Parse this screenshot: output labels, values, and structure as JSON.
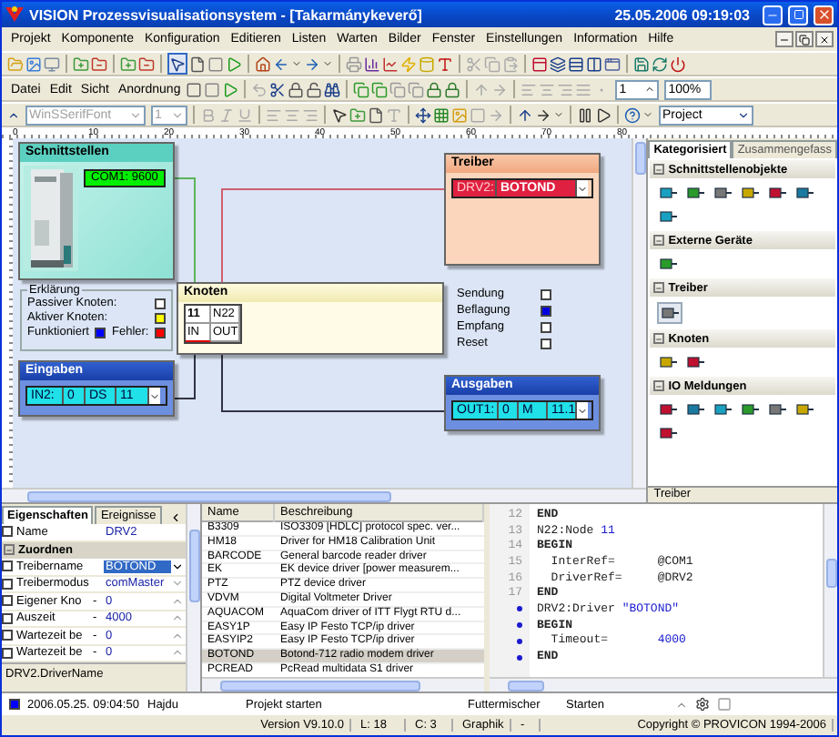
{
  "window": {
    "title": "VISION Prozessvisualisationsystem - [Takarmánykeverő]",
    "clock": "25.05.2006 09:19:03"
  },
  "menu": [
    "Projekt",
    "Komponente",
    "Konfiguration",
    "Editieren",
    "Listen",
    "Warten",
    "Bilder",
    "Fenster",
    "Einstellungen",
    "Information",
    "Hilfe"
  ],
  "toolbar2": {
    "menus": [
      "Datei",
      "Edit",
      "Sicht",
      "Anordnung"
    ],
    "step_field": "1",
    "zoom_field": "100%"
  },
  "toolbar3": {
    "font": {
      "value": "WinSSerifFont",
      "disabled": true
    },
    "size": {
      "value": "1",
      "disabled": true
    },
    "scope": {
      "value": "Project",
      "disabled": false
    }
  },
  "ruler": {
    "labels": [
      "0",
      "10",
      "20",
      "30",
      "40",
      "50",
      "60",
      "70",
      "80"
    ]
  },
  "canvas": {
    "interfaces": {
      "title": "Schnittstellen",
      "port": "COM1: 9600"
    },
    "legend": {
      "title": "Erklärung",
      "items": [
        {
          "label": "Passiver Knoten:",
          "color": "#ffffff"
        },
        {
          "label": "Aktiver Knoten:",
          "color": "#ffff00"
        },
        {
          "label": "Funktioniert",
          "color": "#0000ff"
        },
        {
          "label": "Fehler:",
          "color": "#ff0000"
        }
      ]
    },
    "inputs": {
      "title": "Eingaben",
      "cells": [
        "IN2:",
        "0",
        "DS",
        "11"
      ]
    },
    "node": {
      "title": "Knoten",
      "cells": [
        "11",
        "N22",
        "IN",
        "OUT"
      ]
    },
    "signals": [
      {
        "label": "Sendung",
        "on": false
      },
      {
        "label": "Beflagung",
        "on": true
      },
      {
        "label": "Empfang",
        "on": false
      },
      {
        "label": "Reset",
        "on": false
      }
    ],
    "driver": {
      "title": "Treiber",
      "cells": [
        "DRV2:",
        "BOTOND"
      ]
    },
    "outputs": {
      "title": "Ausgaben",
      "cells": [
        "OUT1:",
        "0",
        "M",
        "11.1"
      ]
    }
  },
  "palette": {
    "tabs": [
      {
        "label": "Kategorisiert",
        "selected": true
      },
      {
        "label": "Zusammengefass",
        "selected": false
      }
    ],
    "sections": [
      {
        "title": "Schnittstellenobjekte",
        "expanded": true,
        "tools": [
          {
            "selected": false
          },
          {
            "selected": false
          },
          {
            "selected": false
          },
          {
            "selected": false
          },
          {
            "selected": false
          },
          {
            "selected": false
          },
          {
            "selected": false
          }
        ]
      },
      {
        "title": "Externe Geräte",
        "expanded": true,
        "tools": [
          {
            "selected": false
          }
        ]
      },
      {
        "title": "Treiber",
        "expanded": true,
        "tools": [
          {
            "selected": true
          }
        ]
      },
      {
        "title": "Knoten",
        "expanded": true,
        "tools": [
          {
            "selected": false
          },
          {
            "selected": false
          }
        ]
      },
      {
        "title": "IO Meldungen",
        "expanded": true,
        "tools": [
          {
            "selected": false
          },
          {
            "selected": false
          },
          {
            "selected": false
          },
          {
            "selected": false
          },
          {
            "selected": false
          },
          {
            "selected": false
          },
          {
            "selected": false
          }
        ]
      }
    ],
    "footer": "Treiber"
  },
  "properties": {
    "tabs": [
      {
        "label": "Eigenschaften",
        "selected": true
      },
      {
        "label": "Ereignisse",
        "selected": false
      }
    ],
    "rows": [
      {
        "kind": "property",
        "label": "Name",
        "value": "DRV2",
        "selected": false
      },
      {
        "kind": "group",
        "label": "Zuordnen",
        "expanded": true
      },
      {
        "kind": "dropdown",
        "label": "Treibername",
        "value": "BOTOND",
        "selected": true
      },
      {
        "kind": "dropdown",
        "label": "Treibermodus",
        "value": "comMaster",
        "selected": false
      },
      {
        "kind": "spin",
        "label": "Eigener Kno",
        "marker": "-",
        "value": "0",
        "selected": false
      },
      {
        "kind": "spin",
        "label": "Auszeit",
        "marker": "-",
        "value": "4000",
        "selected": false
      },
      {
        "kind": "spin",
        "label": "Wartezeit be",
        "marker": "-",
        "value": "0",
        "selected": false
      },
      {
        "kind": "spin",
        "label": "Wartezeit be",
        "marker": "-",
        "value": "0",
        "selected": false
      }
    ],
    "footer": "DRV2.DriverName"
  },
  "drivers": {
    "columns": [
      "Name",
      "Beschreibung"
    ],
    "rows": [
      {
        "name": "B3309",
        "description": "ISO3309 [HDLC] protocol spec. ver...",
        "selected": false
      },
      {
        "name": "HM18",
        "description": "Driver for HM18 Calibration Unit",
        "selected": false
      },
      {
        "name": "BARCODE",
        "description": "General barcode reader driver",
        "selected": false
      },
      {
        "name": "EK",
        "description": "EK device driver [power measurem...",
        "selected": false
      },
      {
        "name": "PTZ",
        "description": "PTZ device driver",
        "selected": false
      },
      {
        "name": "VDVM",
        "description": "Digital Voltmeter Driver",
        "selected": false
      },
      {
        "name": "AQUACOM",
        "description": "AquaCom driver of ITT Flygt RTU d...",
        "selected": false
      },
      {
        "name": "EASY1P",
        "description": "Easy IP Festo TCP/ip driver",
        "selected": false
      },
      {
        "name": "EASYIP2",
        "description": "Easy IP Festo TCP/ip driver",
        "selected": false
      },
      {
        "name": "BOTOND",
        "description": "Botond-712 radio modem driver",
        "selected": true
      },
      {
        "name": "PCREAD",
        "description": "PcRead multidata S1 driver",
        "selected": false
      }
    ]
  },
  "code": {
    "lines": [
      {
        "gutter": "12",
        "marker": false,
        "tokens": [
          {
            "text": "END",
            "kind": "keyword"
          }
        ]
      },
      {
        "gutter": "13",
        "marker": false,
        "tokens": [
          {
            "text": "N22:Node ",
            "kind": "plain"
          },
          {
            "text": "11",
            "kind": "number"
          }
        ]
      },
      {
        "gutter": "14",
        "marker": false,
        "tokens": [
          {
            "text": "BEGIN",
            "kind": "keyword"
          }
        ]
      },
      {
        "gutter": "15",
        "marker": false,
        "tokens": [
          {
            "text": "  InterRef=      ",
            "kind": "plain"
          },
          {
            "text": "@COM1",
            "kind": "plain"
          }
        ]
      },
      {
        "gutter": "16",
        "marker": false,
        "tokens": [
          {
            "text": "  DriverRef=     ",
            "kind": "plain"
          },
          {
            "text": "@DRV2",
            "kind": "plain"
          }
        ]
      },
      {
        "gutter": "17",
        "marker": false,
        "tokens": [
          {
            "text": "END",
            "kind": "keyword"
          }
        ]
      },
      {
        "marker": true,
        "tokens": [
          {
            "text": "DRV2:Driver ",
            "kind": "plain"
          },
          {
            "text": "\"BOTOND\"",
            "kind": "string"
          }
        ]
      },
      {
        "marker": true,
        "tokens": [
          {
            "text": "BEGIN",
            "kind": "keyword"
          }
        ]
      },
      {
        "marker": true,
        "tokens": [
          {
            "text": "  Timeout=       ",
            "kind": "plain"
          },
          {
            "text": "4000",
            "kind": "number"
          }
        ]
      },
      {
        "marker": true,
        "tokens": [
          {
            "text": "END",
            "kind": "keyword"
          }
        ]
      }
    ]
  },
  "log": {
    "color": "#0000ff",
    "time": "2006.05.25. 09:04:50",
    "user": "Hajdu",
    "message": "Projekt starten",
    "location": "Futtermischer",
    "action": "Starten"
  },
  "status_bar": [
    "Version V9.10.0",
    "L: 18",
    "C: 3",
    "Graphik",
    "-",
    "Copyright © PROVICON 1994-2006"
  ]
}
